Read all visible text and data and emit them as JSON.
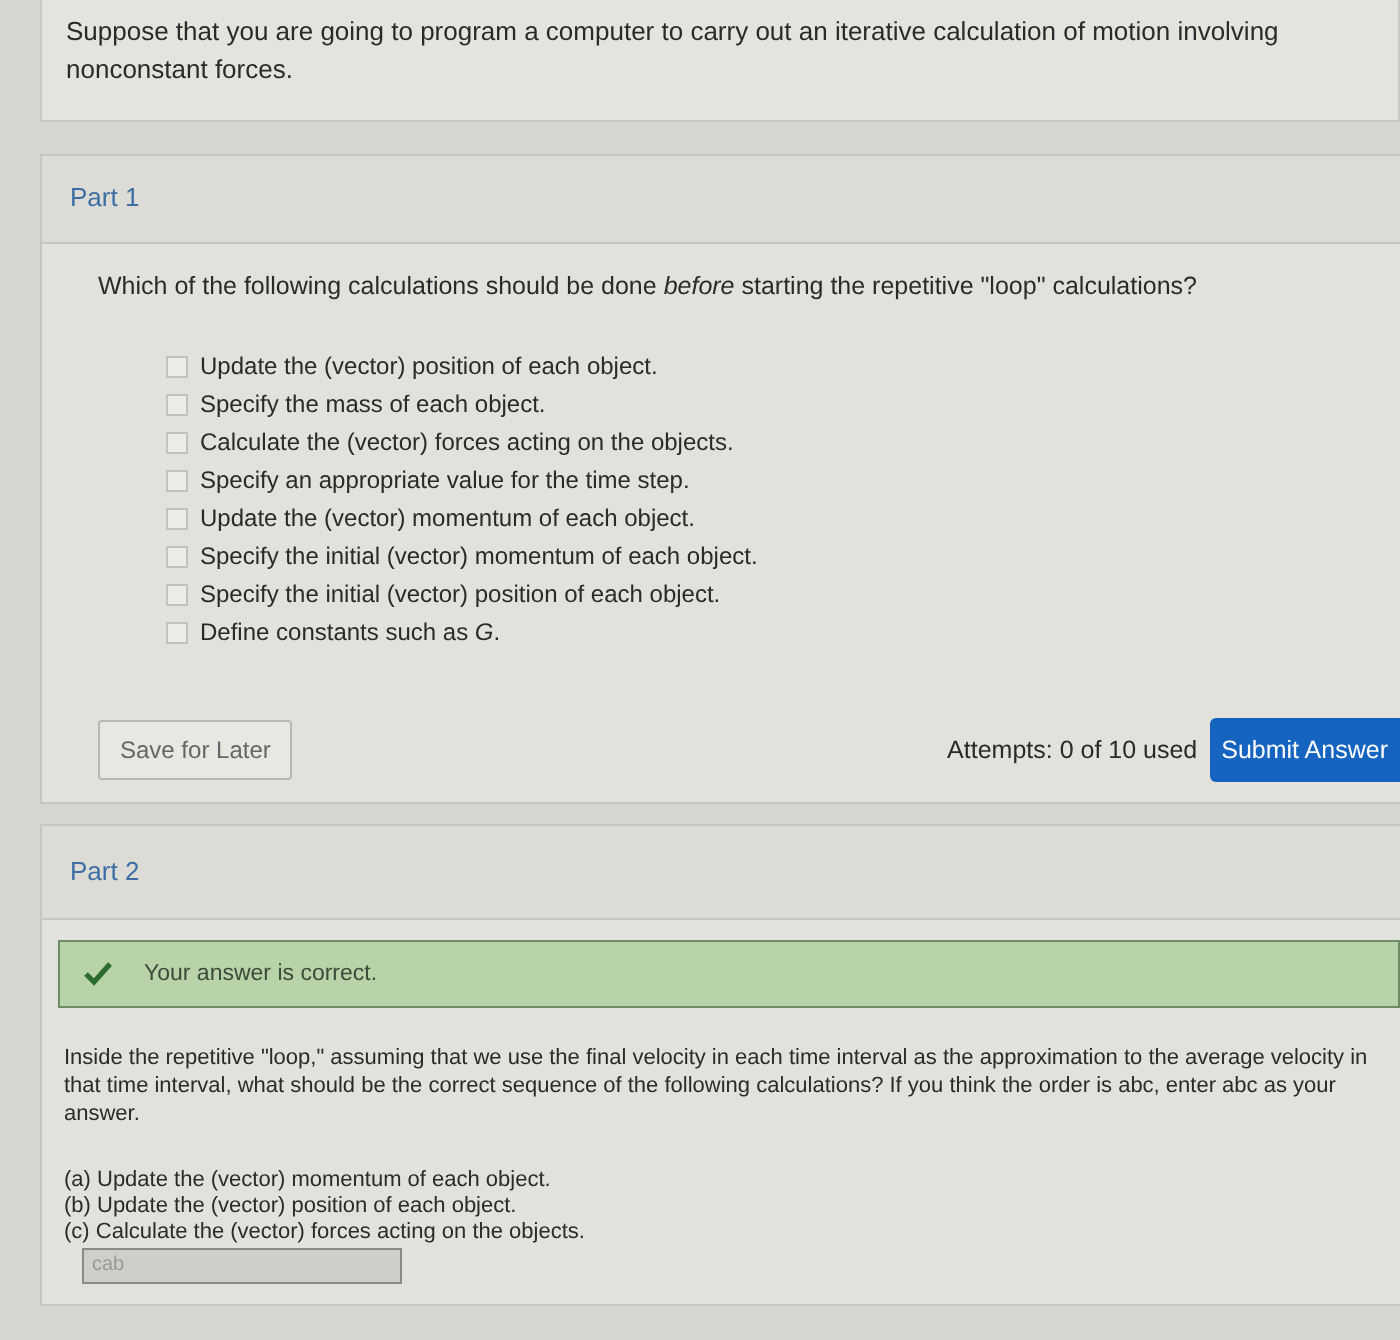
{
  "intro": "Suppose that you are going to program a computer to carry out an iterative calculation of motion involving nonconstant forces.",
  "part1": {
    "title": "Part 1",
    "question": "Which of the following calculations should be done *before* starting the repetitive \"loop\" calculations?",
    "options": [
      {
        "label": "Update the (vector) position of each object.",
        "checked": false
      },
      {
        "label": "Specify the mass of each object.",
        "checked": false
      },
      {
        "label": "Calculate the (vector) forces acting on the objects.",
        "checked": false
      },
      {
        "label": "Specify an appropriate value for the time step.",
        "checked": false
      },
      {
        "label": "Update the (vector) momentum of each object.",
        "checked": false
      },
      {
        "label": "Specify the initial (vector) momentum of each object.",
        "checked": false
      },
      {
        "label": "Specify the initial (vector) position of each object.",
        "checked": false
      },
      {
        "label": "Define constants such as *G*.",
        "checked": false
      }
    ],
    "save_button": "Save for Later",
    "attempts": "Attempts: 0 of 10 used",
    "submit_button": "Submit Answer"
  },
  "part2": {
    "title": "Part 2",
    "feedback": "Your answer is correct.",
    "question": "Inside the repetitive \"loop,\" assuming that we use the final velocity in each time interval as the approximation to the average velocity in that time interval, what should be the correct sequence of the following calculations? If you think the order is abc, enter abc as your answer.",
    "steps": [
      "(a) Update the (vector) momentum of each object.",
      "(b) Update the (vector) position of each object.",
      "(c) Calculate the (vector) forces acting on the objects."
    ],
    "answer": {
      "value": "cab",
      "disabled": true
    }
  }
}
